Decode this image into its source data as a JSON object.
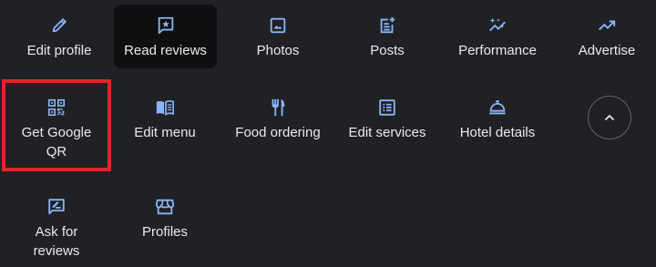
{
  "colors": {
    "background": "#202124",
    "icon": "#8ab4f8",
    "text": "#e8eaed",
    "selected_bg": "#0f0f10",
    "highlight_border": "#e3242b"
  },
  "row1": [
    {
      "label": "Edit profile",
      "icon": "pencil-icon"
    },
    {
      "label": "Read reviews",
      "icon": "star-in-speech-bubble-icon",
      "selected": true
    },
    {
      "label": "Photos",
      "icon": "image-icon"
    },
    {
      "label": "Posts",
      "icon": "add-post-icon"
    },
    {
      "label": "Performance",
      "icon": "sparkle-trend-icon"
    },
    {
      "label": "Advertise",
      "icon": "trending-up-icon"
    }
  ],
  "row2": [
    {
      "label": "Get Google QR",
      "icon": "qr-code-icon",
      "highlighted": true
    },
    {
      "label": "Edit menu",
      "icon": "menu-book-icon"
    },
    {
      "label": "Food ordering",
      "icon": "fork-knife-icon"
    },
    {
      "label": "Edit services",
      "icon": "list-alt-icon"
    },
    {
      "label": "Hotel details",
      "icon": "room-service-bell-icon"
    }
  ],
  "row3": [
    {
      "label": "Ask for reviews",
      "icon": "rate-review-icon"
    },
    {
      "label": "Profiles",
      "icon": "storefront-icon"
    }
  ],
  "collapse_button": {
    "icon": "chevron-up-icon"
  }
}
